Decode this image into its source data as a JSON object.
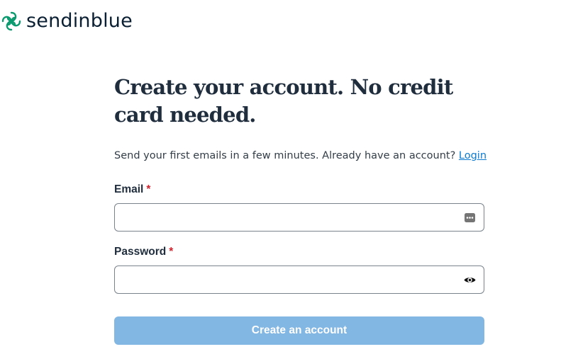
{
  "brand": {
    "name": "sendinblue",
    "icon": "sendinblue-swirl-icon",
    "color": "#0b996e"
  },
  "signup": {
    "headline": "Create your account. No credit card needed.",
    "subtitle_text": "Send your first emails in a few minutes. Already have an account?",
    "login_link": "Login",
    "email": {
      "label": "Email",
      "required_mark": "*",
      "value": "",
      "icon": "autofill-dots-icon"
    },
    "password": {
      "label": "Password",
      "required_mark": "*",
      "value": "",
      "icon": "eye-icon"
    },
    "submit_label": "Create an account"
  },
  "colors": {
    "primary_disabled": "#82b6e3",
    "link": "#0b7ad1",
    "required": "#d1242f",
    "text": "#1f2d3d"
  }
}
